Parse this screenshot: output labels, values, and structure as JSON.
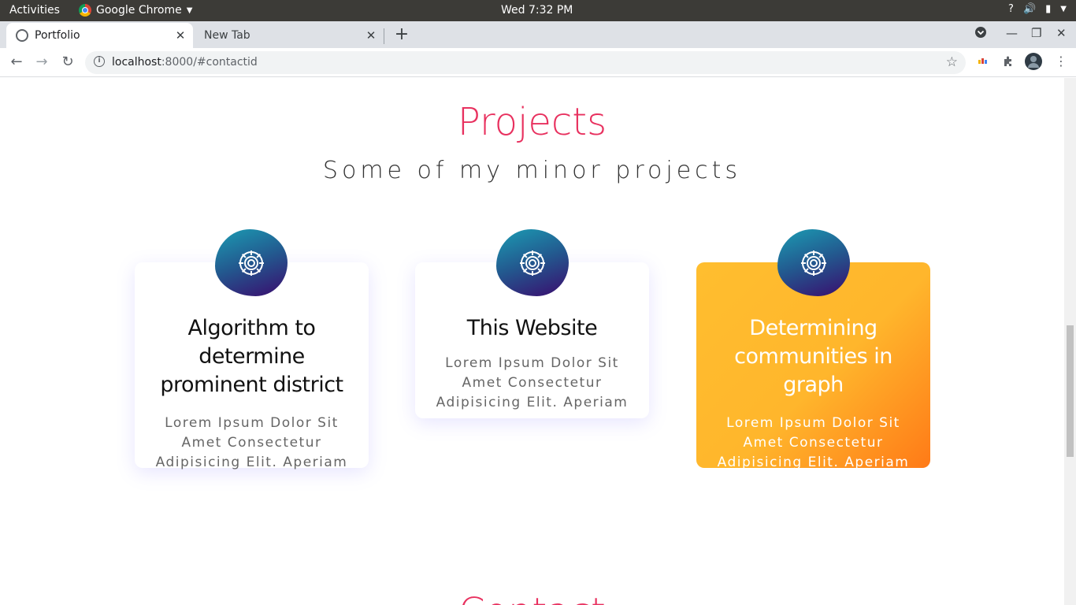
{
  "os": {
    "activities": "Activities",
    "app_name": "Google Chrome",
    "clock": "Wed  7:32 PM"
  },
  "browser": {
    "tabs": [
      {
        "title": "Portfolio",
        "active": true
      },
      {
        "title": "New Tab",
        "active": false
      }
    ],
    "url_host": "localhost",
    "url_path": ":8000/#contactid"
  },
  "page": {
    "projects_title": "Projects",
    "projects_subtitle": "Some of my minor projects",
    "contact_title": "Contact",
    "cards": [
      {
        "title": "Algorithm to determine prominent district",
        "desc": "Lorem Ipsum Dolor Sit Amet Consectetur Adipisicing Elit. Aperiam",
        "icon": "gear-icon"
      },
      {
        "title": "This Website",
        "desc": "Lorem Ipsum Dolor Sit Amet Consectetur Adipisicing Elit. Aperiam",
        "icon": "gear-icon"
      },
      {
        "title": "Determining communities in graph",
        "desc": "Lorem Ipsum Dolor Sit Amet Consectetur Adipisicing Elit. Aperiam",
        "icon": "gear-icon"
      }
    ]
  },
  "colors": {
    "accent": "#e8315f",
    "card_highlight_start": "#ffbe2f",
    "card_highlight_end": "#ff7a17",
    "icon_blob_start": "#1b9cb3",
    "icon_blob_end": "#3a0b6e"
  }
}
